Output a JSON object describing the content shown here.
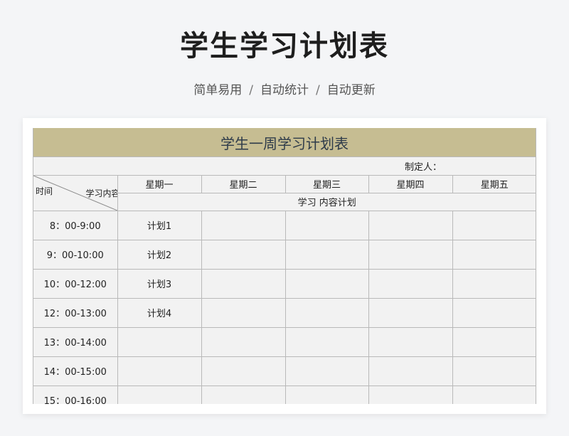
{
  "header": {
    "title": "学生学习计划表",
    "subtitle_items": [
      "简单易用",
      "自动统计",
      "自动更新"
    ],
    "separator": "/"
  },
  "sheet": {
    "title": "学生一周学习计划表",
    "maker_label": "制定人："
  },
  "table": {
    "corner_left": "时间",
    "corner_right": "学习内容",
    "days": [
      "星期一",
      "星期二",
      "星期三",
      "星期四",
      "星期五"
    ],
    "plan_header": "学习 内容计划",
    "rows": [
      {
        "time": "8：00-9:00",
        "cells": [
          "计划1",
          "",
          "",
          "",
          ""
        ]
      },
      {
        "time": "9：00-10:00",
        "cells": [
          "计划2",
          "",
          "",
          "",
          ""
        ]
      },
      {
        "time": "10：00-12:00",
        "cells": [
          "计划3",
          "",
          "",
          "",
          ""
        ]
      },
      {
        "time": "12：00-13:00",
        "cells": [
          "计划4",
          "",
          "",
          "",
          ""
        ]
      },
      {
        "time": "13：00-14:00",
        "cells": [
          "",
          "",
          "",
          "",
          ""
        ]
      },
      {
        "time": "14：00-15:00",
        "cells": [
          "",
          "",
          "",
          "",
          ""
        ]
      },
      {
        "time": "15：00-16:00",
        "cells": [
          "",
          "",
          "",
          "",
          ""
        ]
      }
    ]
  },
  "colors": {
    "background": "#f4f5f7",
    "title_band": "#c6bd92",
    "sheet_bg": "#f2f2f2",
    "grid": "#b9b9b9"
  }
}
